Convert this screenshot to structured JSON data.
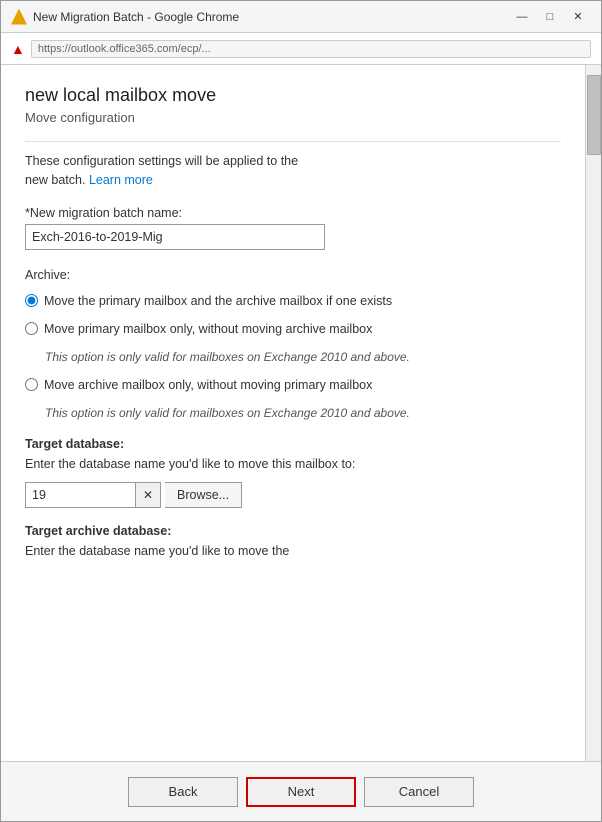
{
  "window": {
    "title": "New Migration Batch - Google Chrome",
    "minimize_label": "—",
    "maximize_label": "□",
    "close_label": "✕"
  },
  "address_bar": {
    "warning_symbol": "▲",
    "url": "https://outlook.office365.com/ecp/..."
  },
  "page": {
    "title": "new local mailbox move",
    "subtitle": "Move configuration",
    "description_line1": "These configuration settings will be applied to the",
    "description_line2": "new batch.",
    "learn_more_label": "Learn more",
    "batch_name_label": "*New migration batch name:",
    "batch_name_value": "Exch-2016-to-2019-Mig",
    "archive_label": "Archive:",
    "archive_options": [
      {
        "id": "opt1",
        "label": "Move the primary mailbox and the archive mailbox if one exists",
        "checked": true,
        "note": null
      },
      {
        "id": "opt2",
        "label": "Move primary mailbox only, without moving archive mailbox",
        "checked": false,
        "note": "This option is only valid for mailboxes on Exchange 2010 and above."
      },
      {
        "id": "opt3",
        "label": "Move archive mailbox only, without moving primary mailbox",
        "checked": false,
        "note": "This option is only valid for mailboxes on Exchange 2010 and above."
      }
    ],
    "target_db_label": "Target database:",
    "target_db_description": "Enter the database name you'd like to move this mailbox to:",
    "target_db_value": "19",
    "clear_btn_label": "✕",
    "browse_btn_label": "Browse...",
    "target_archive_label": "Target archive database:",
    "target_archive_description": "Enter the database name you'd like to move the"
  },
  "footer": {
    "back_label": "Back",
    "next_label": "Next",
    "cancel_label": "Cancel"
  }
}
